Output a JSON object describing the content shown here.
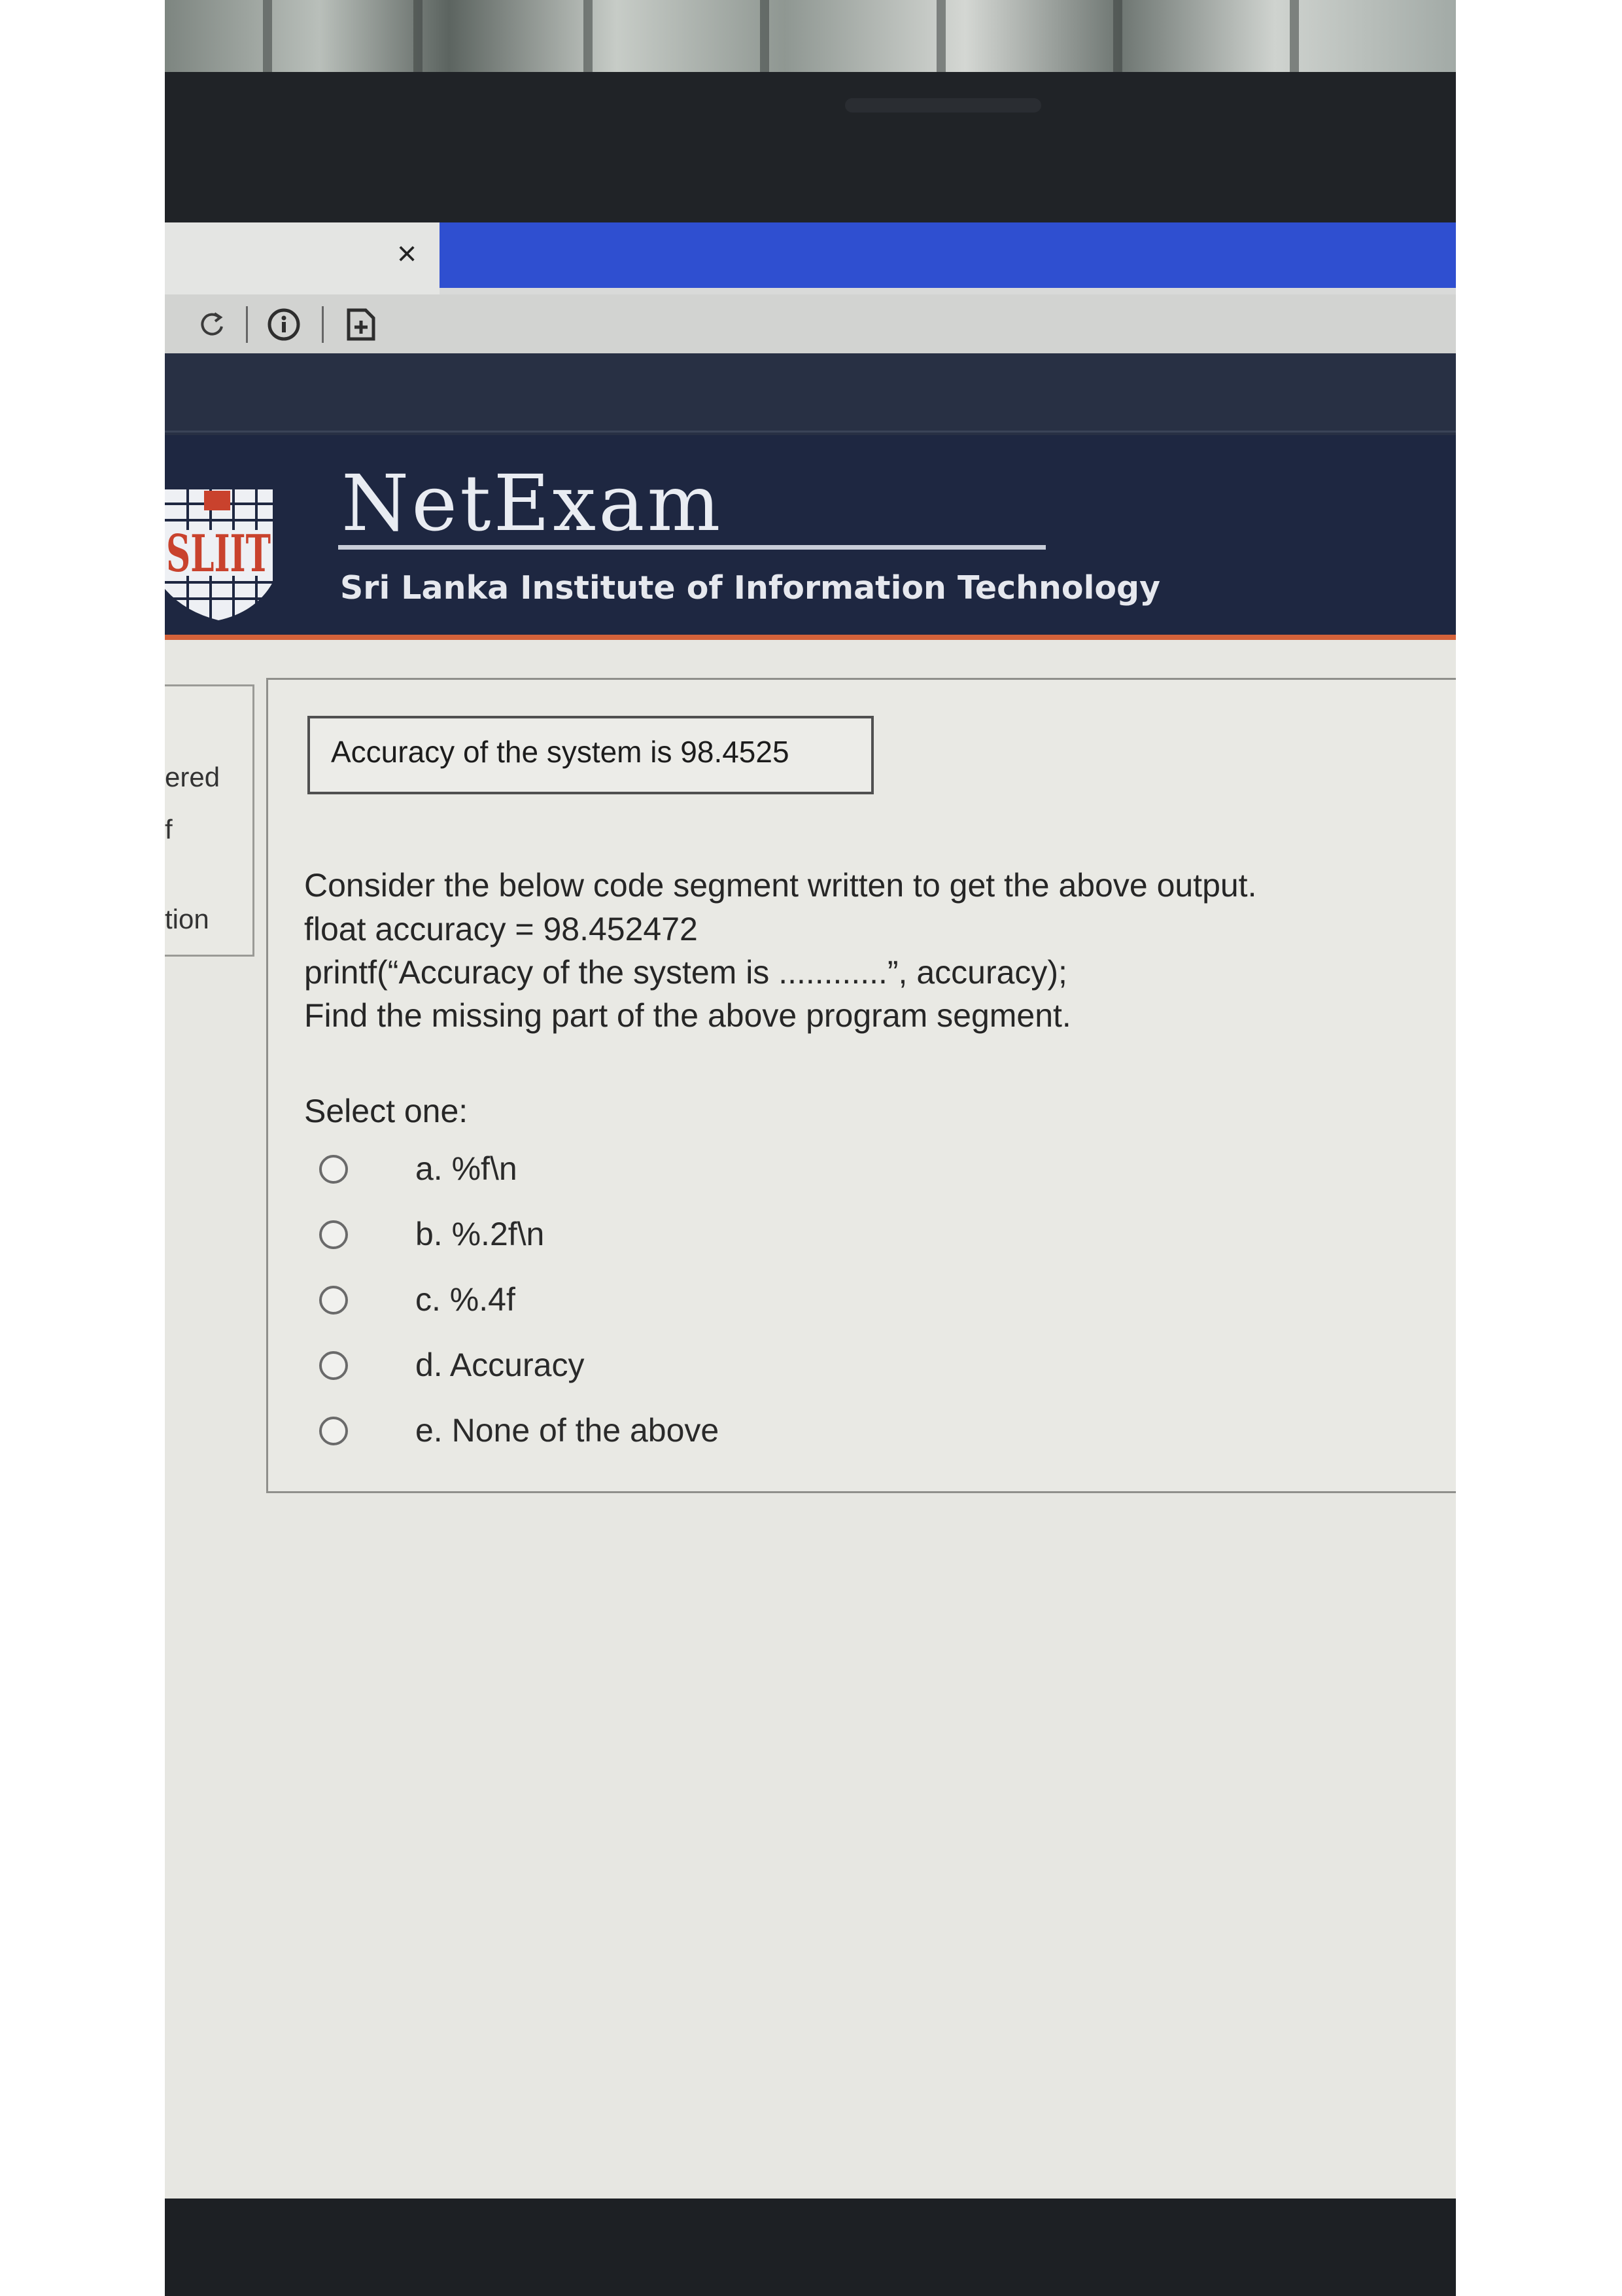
{
  "browser": {
    "tab_close": "×"
  },
  "header": {
    "brand": "NetExam",
    "subtitle": "Sri Lanka Institute of Information Technology",
    "logo_text": "SLIIT"
  },
  "sidebar": {
    "labels": [
      "ered",
      "f",
      "tion"
    ]
  },
  "question": {
    "output_box": "Accuracy of the system is 98.4525",
    "lines": [
      "Consider the below code segment written to get the above output.",
      "float accuracy = 98.452472",
      "printf(“Accuracy of the system is ............”, accuracy);",
      "Find the missing part of the above program segment."
    ],
    "select_label": "Select one:",
    "options": [
      "a. %f\\n",
      "b. %.2f\\n",
      "c. %.4f",
      "d. Accuracy",
      "e. None of the above"
    ]
  },
  "colors": {
    "header_bg": "#1e2741",
    "accent_orange": "#d4623a",
    "tab_blue": "#2f4fd0"
  },
  "icons": [
    "reload-icon",
    "info-icon",
    "add-page-icon",
    "close-icon"
  ]
}
